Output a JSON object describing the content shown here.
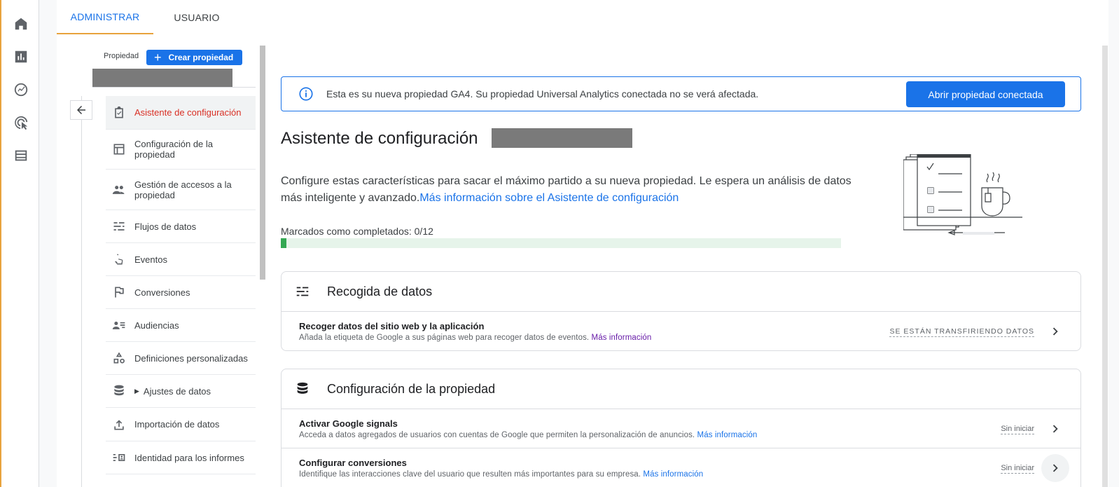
{
  "rail": {
    "icons": [
      "home-icon",
      "reports-icon",
      "explore-icon",
      "advertising-icon",
      "configure-icon"
    ]
  },
  "tabs": [
    {
      "label": "ADMINISTRAR",
      "active": true
    },
    {
      "label": "USUARIO",
      "active": false
    }
  ],
  "property": {
    "label": "Propiedad",
    "create_button": "Crear propiedad"
  },
  "nav": {
    "items": [
      {
        "label": "Asistente de configuración",
        "icon": "checklist-icon",
        "active": true
      },
      {
        "label": "Configuración de la propiedad",
        "icon": "property-settings-icon"
      },
      {
        "label": "Gestión de accesos a la propiedad",
        "icon": "people-icon"
      },
      {
        "label": "Flujos de datos",
        "icon": "data-streams-icon"
      },
      {
        "label": "Eventos",
        "icon": "touch-icon"
      },
      {
        "label": "Conversiones",
        "icon": "flag-icon"
      },
      {
        "label": "Audiencias",
        "icon": "audience-icon"
      },
      {
        "label": "Definiciones personalizadas",
        "icon": "shapes-icon"
      },
      {
        "label": "Ajustes de datos",
        "icon": "database-icon",
        "expandable": true
      },
      {
        "label": "Importación de datos",
        "icon": "upload-icon"
      },
      {
        "label": "Identidad para los informes",
        "icon": "identity-icon"
      }
    ]
  },
  "banner": {
    "text": "Esta es su nueva propiedad GA4. Su propiedad Universal Analytics conectada no se verá afectada.",
    "button": "Abrir propiedad conectada"
  },
  "main": {
    "title": "Asistente de configuración",
    "intro": "Configure estas características para sacar el máximo partido a su nueva propiedad. Le espera un análisis de datos más inteligente y avanzado.",
    "intro_link": "Más información sobre el Asistente de configuración",
    "progress_label": "Marcados como completados: 0/12",
    "progress_fraction": 0.01
  },
  "cards": {
    "collection": {
      "title": "Recogida de datos",
      "rows": [
        {
          "title": "Recoger datos del sitio web y la aplicación",
          "desc": "Añada la etiqueta de Google a sus páginas web para recoger datos de eventos.",
          "link": "Más información",
          "status": "SE ESTÁN TRANSFIRIENDO DATOS"
        }
      ]
    },
    "property": {
      "title": "Configuración de la propiedad",
      "rows": [
        {
          "title": "Activar Google signals",
          "desc": "Acceda a datos agregados de usuarios con cuentas de Google que permiten la personalización de anuncios.",
          "link": "Más información",
          "status": "Sin iniciar"
        },
        {
          "title": "Configurar conversiones",
          "desc": "Identifique las interacciones clave del usuario que resulten más importantes para su empresa.",
          "link": "Más información",
          "status": "Sin iniciar"
        }
      ]
    }
  },
  "colors": {
    "accent": "#1a73e8",
    "active_nav": "#d93025",
    "tab_indicator": "#e8a33d",
    "progress": "#34a853",
    "visited_link": "#681da8"
  }
}
